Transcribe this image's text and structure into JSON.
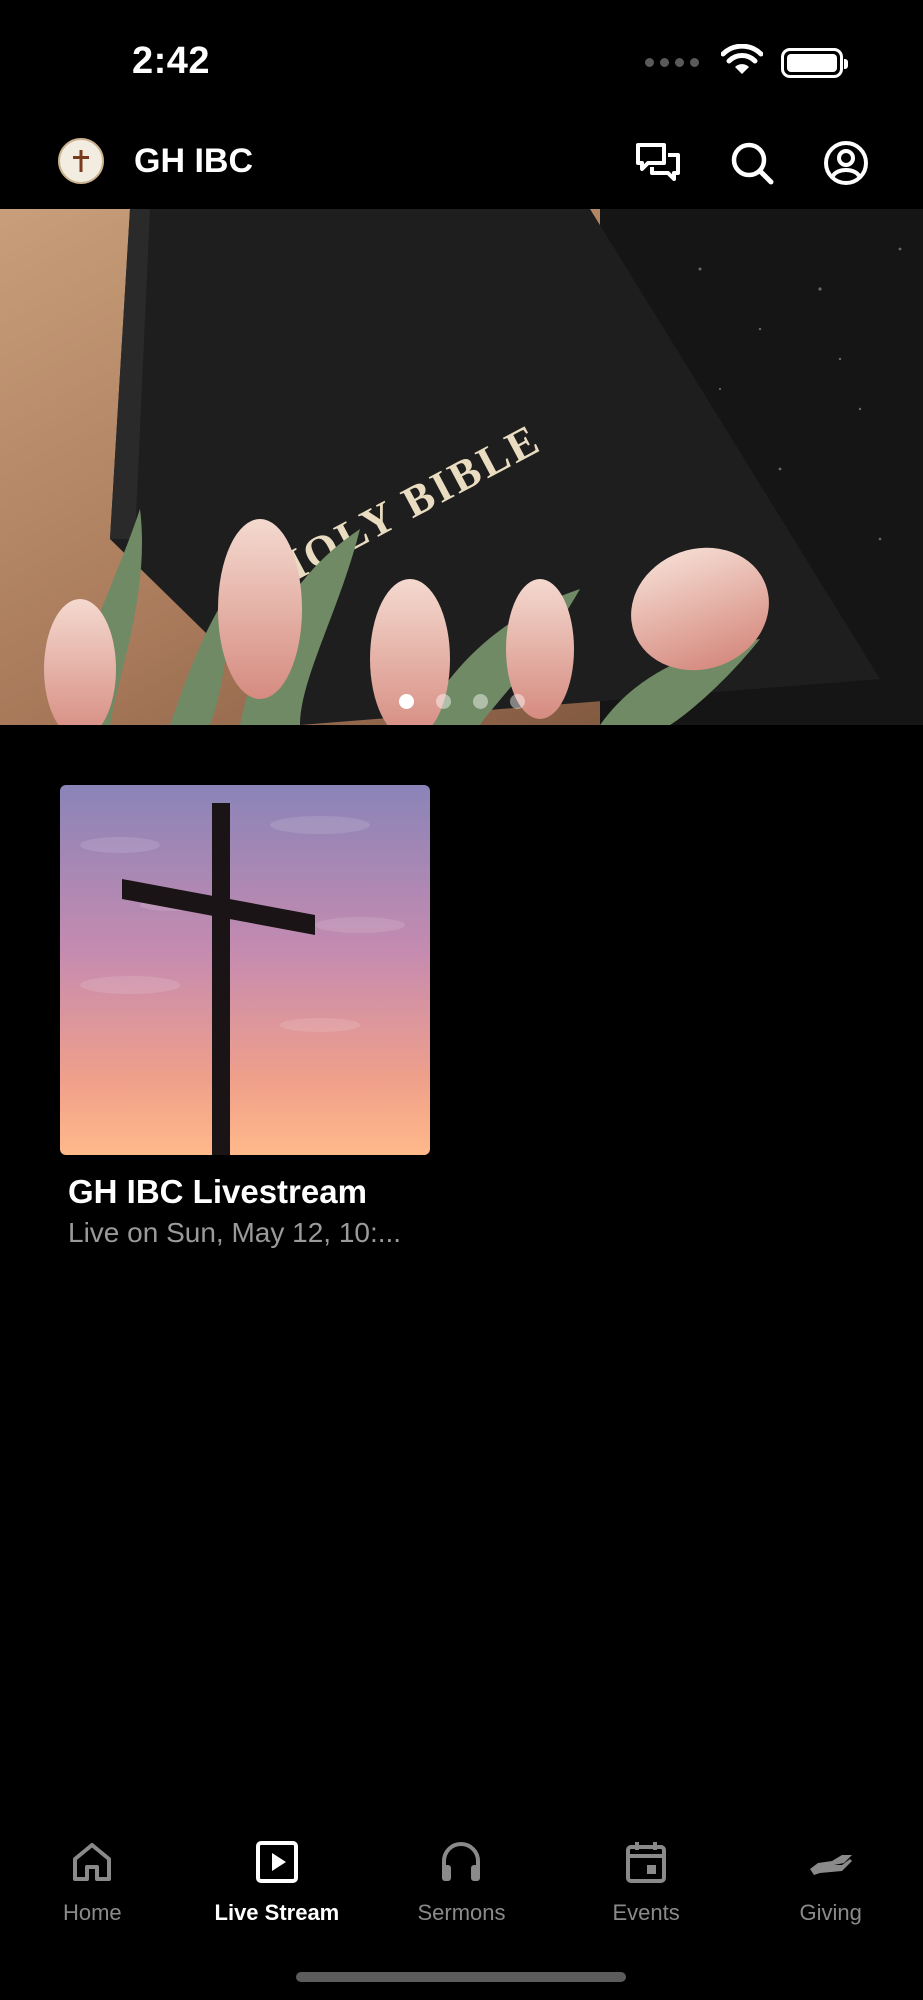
{
  "status_bar": {
    "time": "2:42",
    "icons": [
      "cellular-dots-icon",
      "wifi-icon",
      "battery-icon"
    ]
  },
  "header": {
    "title": "GH IBC",
    "logo_icon": "church-cross-logo",
    "actions": [
      "chat-icon",
      "search-icon",
      "profile-icon"
    ]
  },
  "banner": {
    "book_text": "HOLY BIBLE",
    "slide_count": 4,
    "active_slide": 1
  },
  "livestream_card": {
    "title": "GH IBC Livestream",
    "subtitle": "Live on Sun, May 12, 10:..."
  },
  "tabs": [
    {
      "label": "Home",
      "icon": "home-icon",
      "active": false
    },
    {
      "label": "Live Stream",
      "icon": "play-icon",
      "active": true
    },
    {
      "label": "Sermons",
      "icon": "headphones-icon",
      "active": false
    },
    {
      "label": "Events",
      "icon": "calendar-icon",
      "active": false
    },
    {
      "label": "Giving",
      "icon": "giving-hand-icon",
      "active": false
    }
  ],
  "colors": {
    "background": "#000000",
    "text_primary": "#ffffff",
    "text_secondary": "#9a9a9a",
    "tab_inactive": "#8a8a8a"
  }
}
